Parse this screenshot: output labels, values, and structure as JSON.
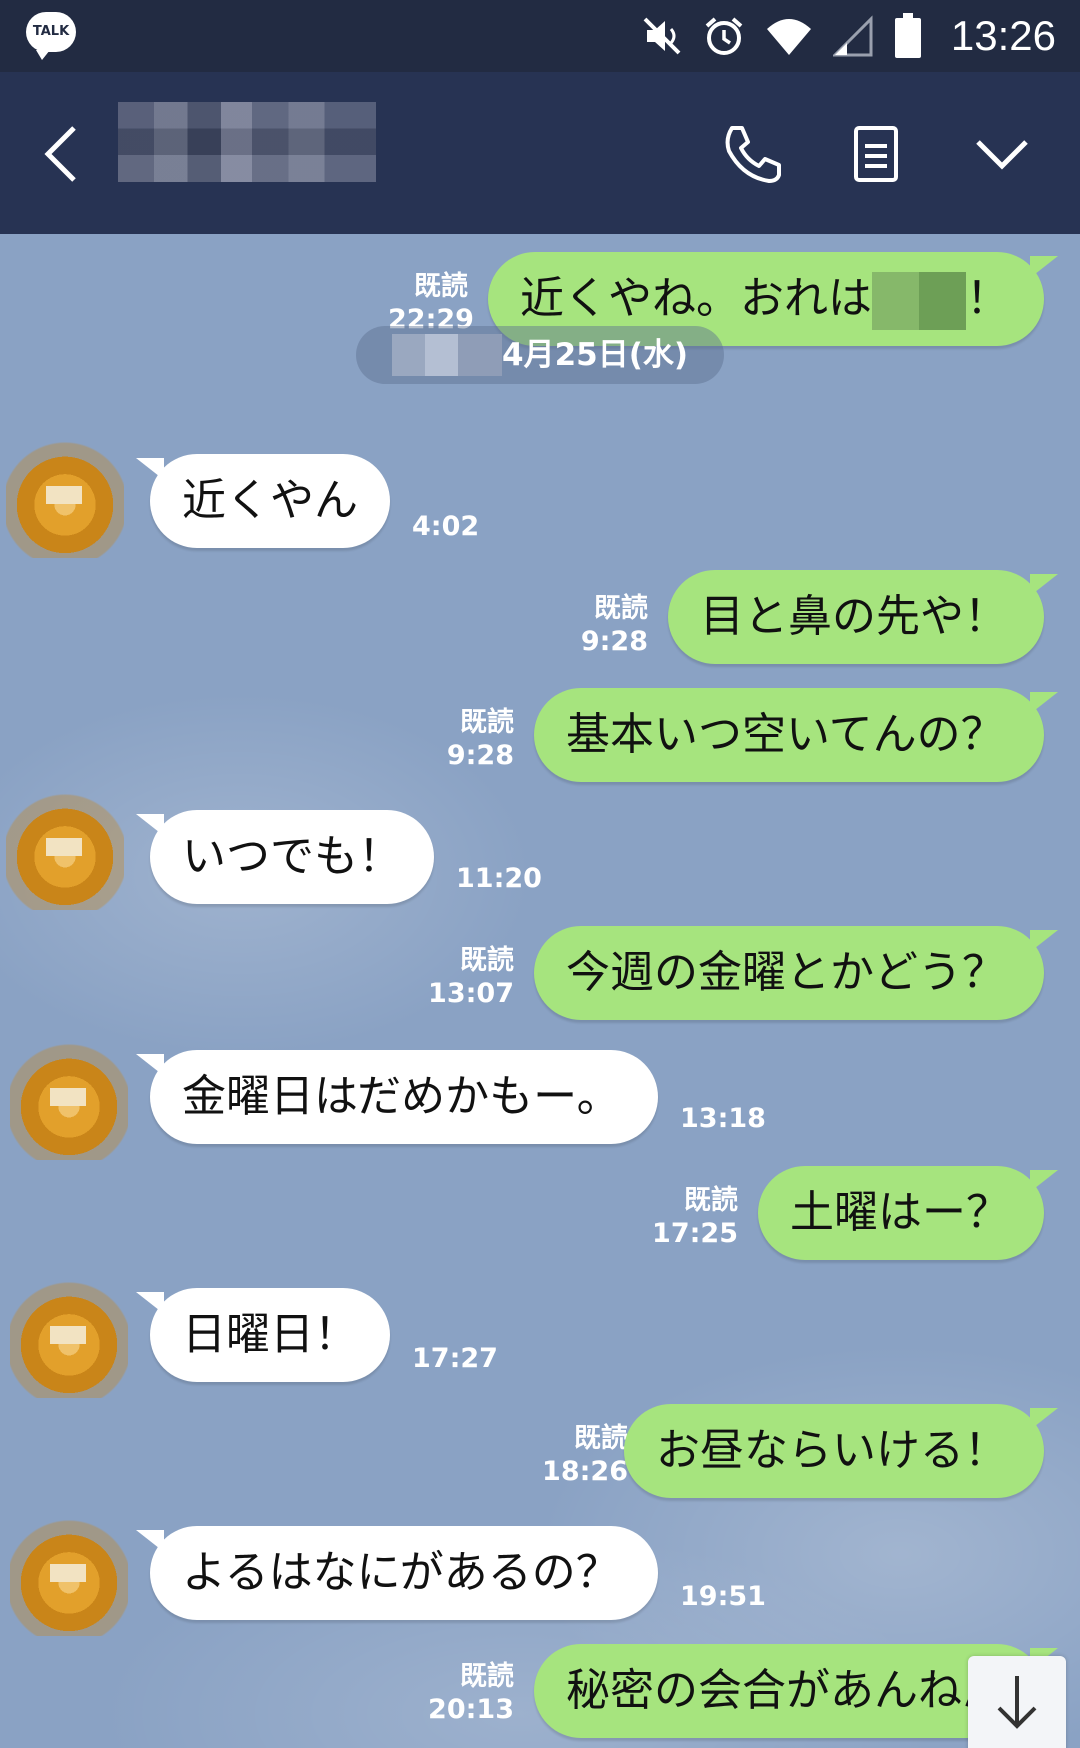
{
  "status_bar": {
    "app_badge": "TALK",
    "time": "13:26",
    "icons": [
      "mute-icon",
      "alarm-icon",
      "wifi-icon",
      "signal-icon",
      "battery-icon"
    ]
  },
  "header": {
    "back_icon": "chevron-left-icon",
    "call_icon": "phone-icon",
    "note_icon": "note-icon",
    "menu_icon": "chevron-down-icon"
  },
  "chat": {
    "date_label": "4月25日(水)",
    "messages": [
      {
        "side": "sent",
        "text_before": "近くやね。おれは",
        "text_after": "！",
        "read": "既読",
        "time": "22:29"
      },
      {
        "side": "recv",
        "text": "近くやん",
        "time": "4:02"
      },
      {
        "side": "sent",
        "text": "目と鼻の先や！",
        "read": "既読",
        "time": "9:28"
      },
      {
        "side": "sent",
        "text": "基本いつ空いてんの？",
        "read": "既読",
        "time": "9:28"
      },
      {
        "side": "recv",
        "text": "いつでも！",
        "time": "11:20"
      },
      {
        "side": "sent",
        "text": "今週の金曜とかどう？",
        "read": "既読",
        "time": "13:07"
      },
      {
        "side": "recv",
        "text": "金曜日はだめかもー。",
        "time": "13:18"
      },
      {
        "side": "sent",
        "text": "土曜はー？",
        "read": "既読",
        "time": "17:25"
      },
      {
        "side": "recv",
        "text": "日曜日！",
        "time": "17:27"
      },
      {
        "side": "sent",
        "text": "お昼ならいける！",
        "read": "既読",
        "time": "18:26"
      },
      {
        "side": "recv",
        "text": "よるはなにがあるの？",
        "time": "19:51"
      },
      {
        "side": "sent",
        "text": "秘密の会合があんねん",
        "read": "既読",
        "time": "20:13"
      }
    ]
  },
  "colors": {
    "status_bg": "#222b42",
    "header_bg": "#273353",
    "sent_bubble": "#a6e47e",
    "recv_bubble": "#ffffff",
    "chat_bg": "#8aa2c4"
  }
}
